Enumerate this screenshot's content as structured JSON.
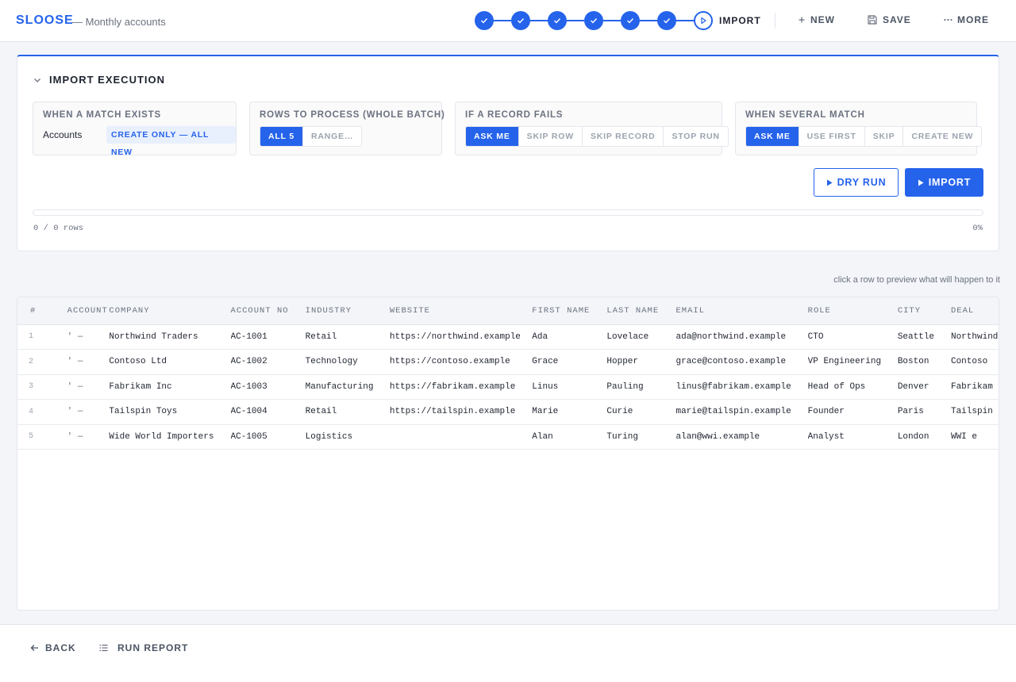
{
  "app": {
    "brand": "SLOOSE",
    "subtitle": "— Monthly accounts"
  },
  "stepper": {
    "current_label": "IMPORT",
    "completed_steps": 6
  },
  "header_actions": {
    "new": "NEW",
    "save": "SAVE",
    "more": "MORE"
  },
  "section": {
    "title": "IMPORT EXECUTION"
  },
  "match_exists": {
    "title": "WHEN A MATCH EXISTS",
    "entity": "Accounts",
    "value": "CREATE ONLY — ALL NEW"
  },
  "rows_to_process": {
    "title": "ROWS TO PROCESS (WHOLE BATCH)",
    "options": [
      "ALL 5",
      "RANGE…"
    ],
    "selected": 0
  },
  "record_fails": {
    "title": "IF A RECORD FAILS",
    "options": [
      "ASK ME",
      "SKIP ROW",
      "SKIP RECORD",
      "STOP RUN"
    ],
    "selected": 0
  },
  "several_match": {
    "title": "WHEN SEVERAL MATCH",
    "options": [
      "ASK ME",
      "USE FIRST",
      "SKIP",
      "CREATE NEW"
    ],
    "selected": 0
  },
  "buttons": {
    "dry_run": "DRY RUN",
    "import": "IMPORT"
  },
  "progress": {
    "rows_text": "0 / 0 rows",
    "percent_text": "0%",
    "fraction": 0
  },
  "hint": "click a row to preview what will happen to it",
  "table": {
    "headers": [
      "#",
      "ACCOUNT",
      "COMPANY",
      "ACCOUNT NO",
      "INDUSTRY",
      "WEBSITE",
      "FIRST NAME",
      "LAST NAME",
      "EMAIL",
      "ROLE",
      "CITY",
      "DEAL"
    ],
    "rows": [
      [
        "1",
        "' —",
        "Northwind Traders",
        "AC-1001",
        "Retail",
        "https://northwind.example",
        "Ada",
        "Lovelace",
        "ada@northwind.example",
        "CTO",
        "Seattle",
        "Northwind"
      ],
      [
        "2",
        "' —",
        "Contoso Ltd",
        "AC-1002",
        "Technology",
        "https://contoso.example",
        "Grace",
        "Hopper",
        "grace@contoso.example",
        "VP Engineering",
        "Boston",
        "Contoso"
      ],
      [
        "3",
        "' —",
        "Fabrikam Inc",
        "AC-1003",
        "Manufacturing",
        "https://fabrikam.example",
        "Linus",
        "Pauling",
        "linus@fabrikam.example",
        "Head of Ops",
        "Denver",
        "Fabrikam"
      ],
      [
        "4",
        "' —",
        "Tailspin Toys",
        "AC-1004",
        "Retail",
        "https://tailspin.example",
        "Marie",
        "Curie",
        "marie@tailspin.example",
        "Founder",
        "Paris",
        "Tailspin"
      ],
      [
        "5",
        "' —",
        "Wide World Importers",
        "AC-1005",
        "Logistics",
        "",
        "Alan",
        "Turing",
        "alan@wwi.example",
        "Analyst",
        "London",
        "WWI e"
      ]
    ]
  },
  "footer": {
    "back": "BACK",
    "run_report": "RUN REPORT"
  },
  "colors": {
    "accent": "#2563eb",
    "accent_soft": "#e8effd",
    "text": "#1f2430",
    "muted": "#6b7280"
  },
  "icons": {
    "step_done": "check-icon",
    "step_current": "play-icon",
    "new": "plus-icon",
    "save": "floppy-icon",
    "more": "dots-icon",
    "collapse": "chevron-down-icon",
    "back": "arrow-left-icon",
    "report": "list-icon"
  }
}
